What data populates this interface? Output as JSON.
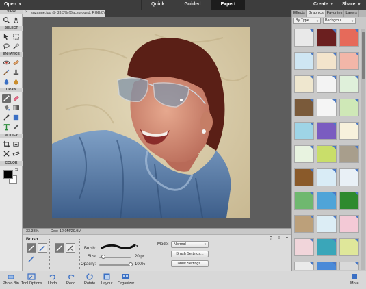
{
  "topbar": {
    "open_label": "Open",
    "modes": [
      "Quick",
      "Guided",
      "Expert"
    ],
    "active_mode": "Expert",
    "create_label": "Create",
    "share_label": "Share"
  },
  "toolbox": {
    "sections": [
      "VIEW",
      "SELECT",
      "ENHANCE",
      "DRAW",
      "MODIFY",
      "COLOR"
    ]
  },
  "document": {
    "tab_title": "suzanne.jpg @ 33.3% (Background, RGB/8) *"
  },
  "status": {
    "zoom": "33.33%",
    "doc_size": "Doc: 12.0M/29.9M"
  },
  "options": {
    "group_label": "Brush",
    "brush_label": "Brush:",
    "size_label": "Size:",
    "size_value": "20 px",
    "size_fraction": 0.12,
    "opacity_label": "Opacity:",
    "opacity_value": "100%",
    "opacity_fraction": 1.0,
    "mode_label": "Mode:",
    "mode_value": "Normal",
    "brush_settings_label": "Brush Settings...",
    "tablet_settings_label": "Tablet Settings..."
  },
  "right_panel": {
    "tabs": [
      "Effects",
      "Graphics",
      "Favorites",
      "Layers"
    ],
    "active_tab": "Graphics",
    "filter_by": "By Type",
    "filter_category": "Backgrou..."
  },
  "taskbar": {
    "items": [
      "Photo Bin",
      "Tool Options",
      "Undo",
      "Redo",
      "Rotate",
      "Layout",
      "Organizer"
    ],
    "more_label": "More"
  },
  "colors": {
    "accent": "#4a79c6",
    "foreground_color": "#000000",
    "background_color": "#ffffff"
  }
}
